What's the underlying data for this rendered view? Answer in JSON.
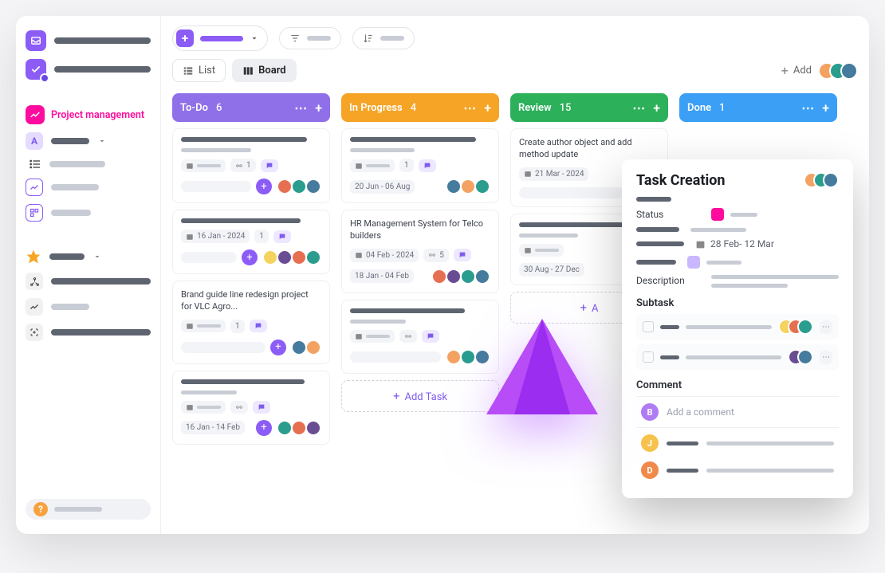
{
  "sidebar": {
    "project_label": "Project management",
    "badge_letter": "A",
    "help_mark": "?"
  },
  "toolbar": {
    "list_label": "List",
    "board_label": "Board",
    "add_label": "Add"
  },
  "columns": [
    {
      "title": "To-Do",
      "count": 6,
      "color": "#8f70e8"
    },
    {
      "title": "In Progress",
      "count": 4,
      "color": "#f5a426"
    },
    {
      "title": "Review",
      "count": 15,
      "color": "#2cb05a"
    },
    {
      "title": "Done",
      "count": 1,
      "color": "#3a9ff5"
    }
  ],
  "cards": {
    "todo": [
      {
        "date": "",
        "sub": "1",
        "daterange": ""
      },
      {
        "date": "16 Jan - 2024",
        "sub": "1",
        "daterange": ""
      },
      {
        "title": "Brand guide line redesign project for VLC Agro...",
        "sub": "1",
        "daterange": ""
      },
      {
        "daterange": "16 Jan - 14 Feb"
      }
    ],
    "progress": [
      {
        "daterange": "20 Jun - 06 Aug"
      },
      {
        "title": "HR Management System for Telco builders",
        "date": "04 Feb - 2024",
        "sub": "5",
        "daterange": "18 Jan - 04 Feb"
      },
      {}
    ],
    "review": [
      {
        "title": "Create author object and add method update",
        "date": "21 Mar - 2024"
      },
      {
        "daterange": "30 Aug - 27 Dec"
      }
    ]
  },
  "addtask": {
    "short": "A",
    "label": "Add Task"
  },
  "panel": {
    "title": "Task Creation",
    "status_label": "Status",
    "dates": "28 Feb- 12 Mar",
    "description_label": "Description",
    "subtask_label": "Subtask",
    "comment_label": "Comment",
    "comment_placeholder": "Add a comment",
    "commenters": [
      {
        "letter": "B",
        "color": "#b07cf4"
      },
      {
        "letter": "J",
        "color": "#f7c24b"
      },
      {
        "letter": "D",
        "color": "#f08a4b"
      }
    ]
  },
  "avatars": [
    "#f4a261",
    "#2a9d8f",
    "#457b9d",
    "#e76f51",
    "#6a4c93",
    "#ffb703"
  ]
}
